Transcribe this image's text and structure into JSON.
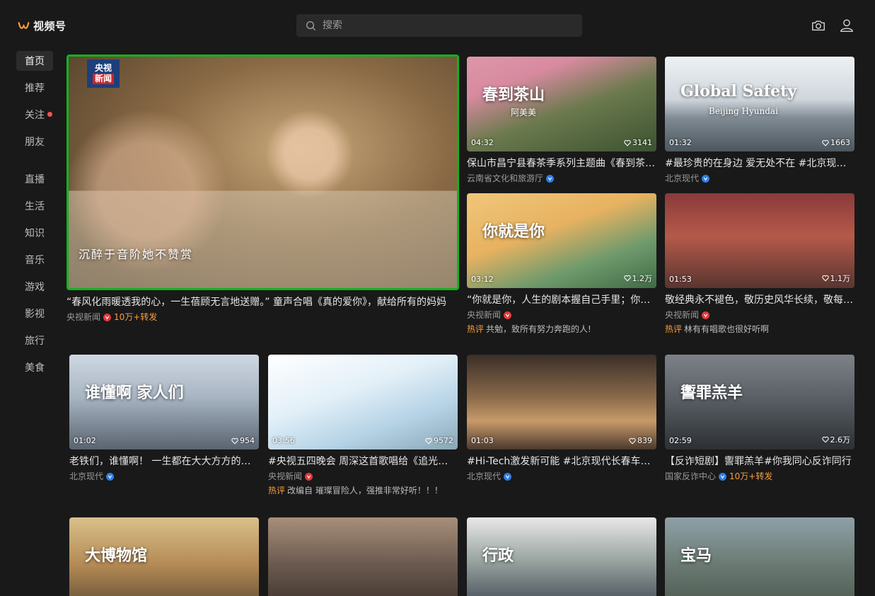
{
  "app": {
    "name": "视频号"
  },
  "search": {
    "placeholder": "搜索"
  },
  "sidebar": {
    "items": [
      {
        "label": "首页",
        "active": true
      },
      {
        "label": "推荐"
      },
      {
        "label": "关注",
        "dot": true
      },
      {
        "label": "朋友"
      },
      {
        "label": "直播"
      },
      {
        "label": "生活"
      },
      {
        "label": "知识"
      },
      {
        "label": "音乐"
      },
      {
        "label": "游戏"
      },
      {
        "label": "影视"
      },
      {
        "label": "旅行"
      },
      {
        "label": "美食"
      }
    ]
  },
  "featured": {
    "title": "“春风化雨暖透我的心，一生蓓顾无言地送赠。” 童声合唱《真的爱你》，献给所有的妈妈",
    "author": "央视新闻",
    "verified": "red",
    "extra": "10万+转发",
    "overlay": "沉醉于音阶她不赞赏",
    "logo": [
      "央视",
      "新闻"
    ]
  },
  "cards": [
    {
      "duration": "04:32",
      "likes": "3141",
      "title": "保山市昌宁县春茶季系列主题曲《春到茶山》",
      "author": "云南省文化和旅游厅",
      "verified": "blue",
      "overlay": "春到茶山",
      "overlay2": "阿美美"
    },
    {
      "duration": "01:32",
      "likes": "1663",
      "title": "#最珍贵的在身边 爱无处不在 #北京现代 #",
      "author": "北京现代",
      "verified": "blue",
      "overlay": "Global Safety",
      "overlay2": "Beijing Hyundai"
    },
    {
      "duration": "03:12",
      "likes": "1.2万",
      "title": "“你就是你，人生的剧本握自己手里；你就是你",
      "author": "央视新闻",
      "verified": "red",
      "hot": "共勉，致所有努力奔跑的人!",
      "overlay": "你就是你"
    },
    {
      "duration": "01:53",
      "likes": "1.1万",
      "title": "敬经典永不褪色，敬历史风华长续，敬每一代",
      "author": "央视新闻",
      "verified": "red",
      "hot": "林有有唱歌也很好听啊"
    },
    {
      "duration": "01:02",
      "likes": "954",
      "title": "老铁们，谁懂啊！ 一生都在大大方方的东北人",
      "author": "北京现代",
      "verified": "blue",
      "overlay": "谁懂啊  家人们"
    },
    {
      "duration": "03:56",
      "likes": "9572",
      "title": "#央视五四晚会 周深这首歌唱给《追光在青春》",
      "author": "央视新闻",
      "verified": "red",
      "hot": "改编自 璀璨冒险人，强推非常好听！！！"
    },
    {
      "duration": "01:03",
      "likes": "839",
      "title": "#Hi-Tech激发新可能 #北京现代长春车展 #",
      "author": "北京现代",
      "verified": "blue"
    },
    {
      "duration": "02:59",
      "likes": "2.6万",
      "title": "【反诈短剧】讆罪羔羊#你我同心反诈同行",
      "author": "国家反诈中心",
      "verified": "blue",
      "extra": "10万+转发",
      "overlay": "讆罪羔羊"
    },
    {
      "overlay": "大博物馆"
    },
    {},
    {
      "overlay": "行政"
    },
    {
      "overlay": "宝马"
    }
  ],
  "hot_label": "热评",
  "icons": {
    "search": "search-icon",
    "camera": "camera-icon",
    "user": "user-icon",
    "heart": "heart-icon"
  },
  "colors": {
    "accent_orange": "#fa9d3b",
    "verified_red": "#e03a3a",
    "verified_blue": "#2f7ee6",
    "selected_border": "#13b21e"
  }
}
